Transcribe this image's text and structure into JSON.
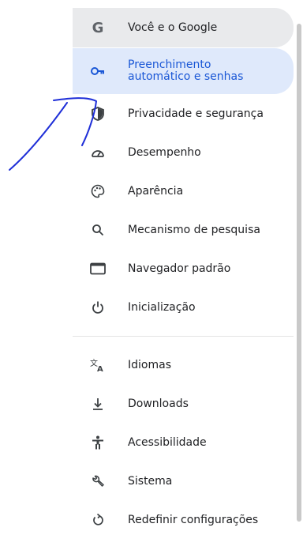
{
  "nav": {
    "items": [
      {
        "label": "Você e o Google"
      },
      {
        "label": "Preenchimento\nautomático e senhas"
      },
      {
        "label": "Privacidade e segurança"
      },
      {
        "label": "Desempenho"
      },
      {
        "label": "Aparência"
      },
      {
        "label": "Mecanismo de pesquisa"
      },
      {
        "label": "Navegador padrão"
      },
      {
        "label": "Inicialização"
      }
    ],
    "more_items": [
      {
        "label": "Idiomas"
      },
      {
        "label": "Downloads"
      },
      {
        "label": "Acessibilidade"
      },
      {
        "label": "Sistema"
      },
      {
        "label": "Redefinir configurações"
      }
    ]
  },
  "icons": {
    "google": "google-icon",
    "key": "key-icon",
    "shield": "shield-icon",
    "performance": "gauge-icon",
    "appearance": "palette-icon",
    "search": "search-icon",
    "browser": "browser-window-icon",
    "power": "power-icon",
    "languages": "translate-icon",
    "downloads": "download-icon",
    "accessibility": "accessibility-icon",
    "system": "wrench-icon",
    "reset": "reset-icon"
  },
  "colors": {
    "accent": "#1a57d6",
    "active_bg": "#dfe9fb",
    "ink": "#1f2fd8"
  }
}
